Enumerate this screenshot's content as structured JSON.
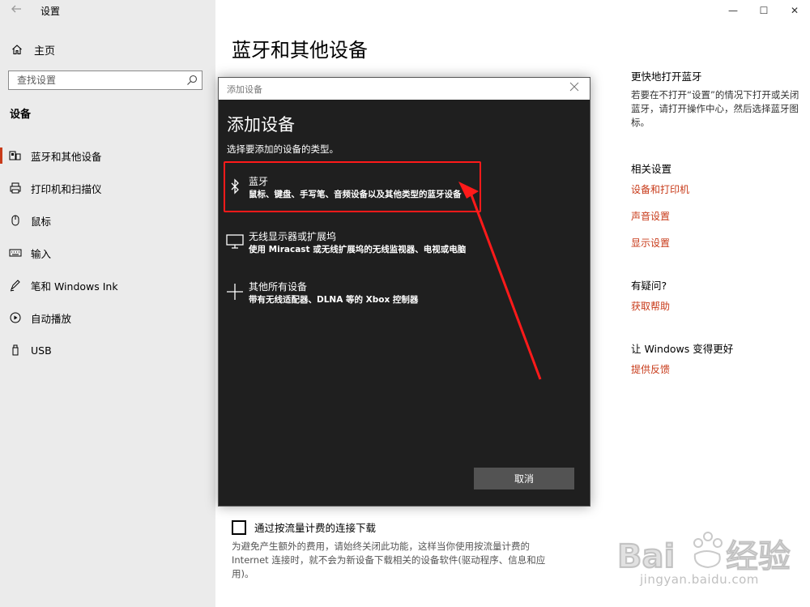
{
  "app": {
    "title": "设置",
    "window_controls": [
      "—",
      "☐",
      "✕"
    ]
  },
  "sidebar": {
    "home_label": "主页",
    "search_placeholder": "查找设置",
    "section": "设备",
    "items": [
      {
        "label": "蓝牙和其他设备",
        "icon": "bluetooth-devices-icon",
        "active": true
      },
      {
        "label": "打印机和扫描仪",
        "icon": "printer-icon",
        "active": false
      },
      {
        "label": "鼠标",
        "icon": "mouse-icon",
        "active": false
      },
      {
        "label": "输入",
        "icon": "keyboard-icon",
        "active": false
      },
      {
        "label": "笔和 Windows Ink",
        "icon": "pen-icon",
        "active": false
      },
      {
        "label": "自动播放",
        "icon": "autoplay-icon",
        "active": false
      },
      {
        "label": "USB",
        "icon": "usb-icon",
        "active": false
      }
    ]
  },
  "main": {
    "title": "蓝牙和其他设备",
    "metered_label": "通过按流量计费的连接下载",
    "metered_desc": "为避免产生额外的费用，请始终关闭此功能，这样当你使用按流量计费的 Internet 连接时，就不会为新设备下载相关的设备软件(驱动程序、信息和应用)。"
  },
  "right_panel": {
    "quick_title": "更快地打开蓝牙",
    "quick_text": "若要在不打开“设置”的情况下打开或关闭蓝牙，请打开操作中心，然后选择蓝牙图标。",
    "related_title": "相关设置",
    "related_links": [
      "设备和打印机",
      "声音设置",
      "显示设置"
    ],
    "question_title": "有疑问?",
    "help_link": "获取帮助",
    "improve_title": "让 Windows 变得更好",
    "feedback_link": "提供反馈"
  },
  "dialog": {
    "window_title": "添加设备",
    "heading": "添加设备",
    "subtitle": "选择要添加的设备的类型。",
    "options": [
      {
        "name": "蓝牙",
        "desc": "鼠标、键盘、手写笔、音频设备以及其他类型的蓝牙设备",
        "icon": "bluetooth-icon"
      },
      {
        "name": "无线显示器或扩展坞",
        "desc": "使用 Miracast 或无线扩展坞的无线监视器、电视或电脑",
        "icon": "monitor-icon"
      },
      {
        "name": "其他所有设备",
        "desc": "带有无线适配器、DLNA 等的 Xbox 控制器",
        "icon": "plus-icon"
      }
    ],
    "cancel_label": "取消"
  },
  "annotation": {
    "color": "#ff1a1a"
  },
  "watermark": {
    "brand": "Baidu 经验",
    "site": "jingyan.baidu.com"
  },
  "colors": {
    "accent": "#c83b1a",
    "dialog_bg": "#1f1f1f",
    "sidebar_bg": "#ebebeb"
  }
}
